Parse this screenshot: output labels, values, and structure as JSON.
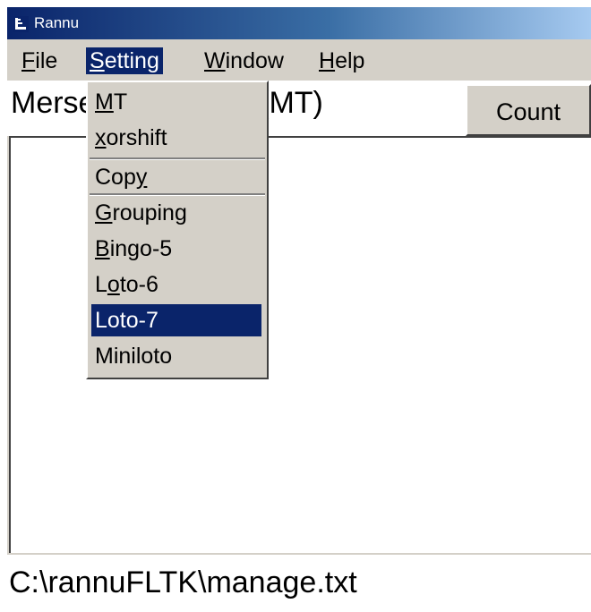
{
  "window": {
    "title": "Rannu"
  },
  "menubar": {
    "items": [
      {
        "label": "File",
        "mnemonic": "F",
        "rest": "ile"
      },
      {
        "label": "Setting",
        "mnemonic": "S",
        "rest": "etting"
      },
      {
        "label": "Window",
        "mnemonic": "W",
        "rest": "indow"
      },
      {
        "label": "Help",
        "mnemonic": "H",
        "rest": "elp"
      }
    ],
    "open_menu": "Setting"
  },
  "header": {
    "text": "Mersenne Twister (MT)",
    "count_button": "Count"
  },
  "dropdown": {
    "items": [
      {
        "label": "MT",
        "pre": "",
        "mnemonic": "M",
        "post": "T"
      },
      {
        "label": "xorshift",
        "pre": "",
        "mnemonic": "x",
        "post": "orshift"
      },
      {
        "label": "Copy",
        "pre": "Cop",
        "mnemonic": "y",
        "post": ""
      },
      {
        "label": "Grouping",
        "pre": "",
        "mnemonic": "G",
        "post": "rouping"
      },
      {
        "label": "Bingo-5",
        "pre": "",
        "mnemonic": "B",
        "post": "ingo-5"
      },
      {
        "label": "Loto-6",
        "pre": "L",
        "mnemonic": "o",
        "post": "to-6"
      },
      {
        "label": "Loto-7",
        "pre": "Loto-7",
        "mnemonic": "",
        "post": ""
      },
      {
        "label": "Miniloto",
        "pre": "Miniloto",
        "mnemonic": "",
        "post": ""
      }
    ],
    "selected": "Loto-7"
  },
  "footer": {
    "path": "C:\\rannuFLTK\\manage.txt"
  },
  "colors": {
    "title_bar_start": "#0a246a",
    "title_bar_end": "#a6caf0",
    "highlight": "#0a246a",
    "face": "#d4d0c8"
  }
}
